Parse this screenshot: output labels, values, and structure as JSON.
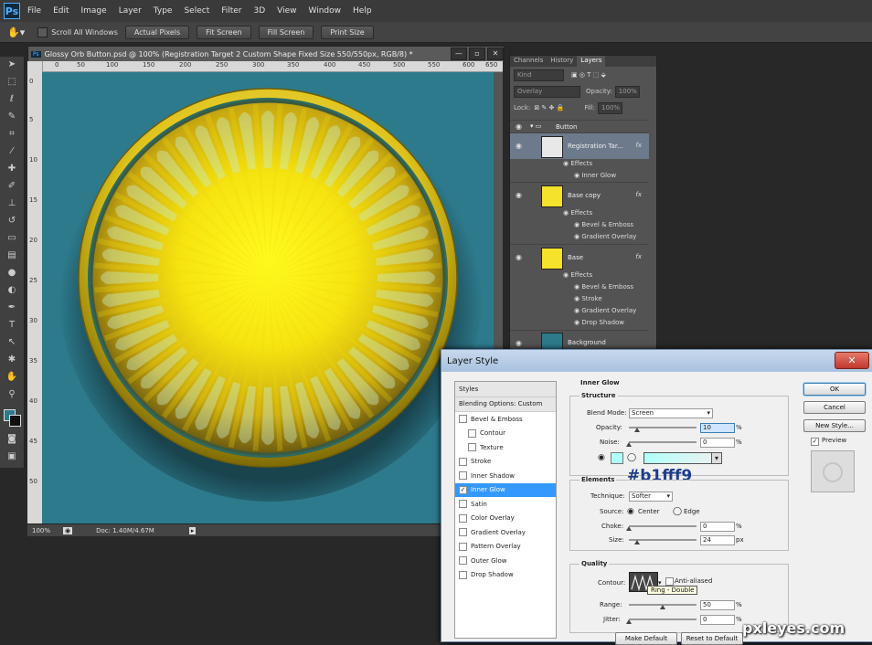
{
  "app": {
    "logo": "Ps"
  },
  "menu": [
    "File",
    "Edit",
    "Image",
    "Layer",
    "Type",
    "Select",
    "Filter",
    "3D",
    "View",
    "Window",
    "Help"
  ],
  "options": {
    "scroll_all": "Scroll All Windows",
    "buttons": [
      "Actual Pixels",
      "Fit Screen",
      "Fill Screen",
      "Print Size"
    ]
  },
  "document": {
    "title": "Glossy Orb Button.psd @ 100% (Registration Target 2 Custom Shape  Fixed Size 550/550px, RGB/8) *",
    "ruler_top": [
      "0",
      "50",
      "100",
      "150",
      "200",
      "250",
      "300",
      "350",
      "400",
      "450",
      "500",
      "550",
      "600",
      "650"
    ],
    "ruler_left": [
      "0",
      "5",
      "10",
      "15",
      "20",
      "25",
      "30",
      "35",
      "40",
      "45",
      "50"
    ],
    "zoom": "100%",
    "doc_info": "Doc: 1.40M/4.67M",
    "canvas_color": "#2d7a8c"
  },
  "panel": {
    "tabs": [
      "Channels",
      "History",
      "Layers"
    ],
    "kind": "Kind",
    "blend": "Overlay",
    "opacity_label": "Opacity:",
    "opacity_value": "100%",
    "lock_label": "Lock:",
    "fill_label": "Fill:",
    "fill_value": "100%",
    "group": "Button",
    "layers": [
      {
        "name": "Registration Tar...",
        "effects_label": "Effects",
        "effects": [
          "Inner Glow"
        ]
      },
      {
        "name": "Base copy",
        "effects_label": "Effects",
        "effects": [
          "Bevel & Emboss",
          "Gradient Overlay"
        ]
      },
      {
        "name": "Base",
        "effects_label": "Effects",
        "effects": [
          "Bevel & Emboss",
          "Stroke",
          "Gradient Overlay",
          "Drop Shadow"
        ]
      },
      {
        "name": "Background"
      }
    ],
    "fx": "fx"
  },
  "dialog": {
    "title": "Layer Style",
    "close": "✕",
    "styles_header": "Styles",
    "blending": "Blending Options: Custom",
    "styles": [
      {
        "label": "Bevel & Emboss",
        "checked": false
      },
      {
        "label": "Contour",
        "checked": false,
        "indent": true
      },
      {
        "label": "Texture",
        "checked": false,
        "indent": true
      },
      {
        "label": "Stroke",
        "checked": false
      },
      {
        "label": "Inner Shadow",
        "checked": false
      },
      {
        "label": "Inner Glow",
        "checked": true
      },
      {
        "label": "Satin",
        "checked": false
      },
      {
        "label": "Color Overlay",
        "checked": false
      },
      {
        "label": "Gradient Overlay",
        "checked": false
      },
      {
        "label": "Pattern Overlay",
        "checked": false
      },
      {
        "label": "Outer Glow",
        "checked": false
      },
      {
        "label": "Drop Shadow",
        "checked": false
      }
    ],
    "section_title": "Inner Glow",
    "structure": "Structure",
    "blend_mode_label": "Blend Mode:",
    "blend_mode": "Screen",
    "opacity_label": "Opacity:",
    "opacity": "10",
    "noise_label": "Noise:",
    "noise": "0",
    "pct": "%",
    "elements": "Elements",
    "technique_label": "Technique:",
    "technique": "Softer",
    "source_label": "Source:",
    "center": "Center",
    "edge": "Edge",
    "choke_label": "Choke:",
    "choke": "0",
    "size_label": "Size:",
    "size": "24",
    "px": "px",
    "quality": "Quality",
    "contour_label": "Contour:",
    "anti_aliased": "Anti-aliased",
    "contour_tip": "Ring - Double",
    "range_label": "Range:",
    "range": "50",
    "jitter_label": "Jitter:",
    "jitter": "0",
    "make_default": "Make Default",
    "reset_default": "Reset to Default",
    "ok": "OK",
    "cancel": "Cancel",
    "new_style": "New Style...",
    "preview": "Preview",
    "glow_color": "#b1fff9",
    "annotation": "#b1fff9"
  },
  "watermark": "pxleyes.com",
  "icons": {
    "eye": "eye-icon",
    "folder": "folder-icon",
    "hand": "hand-tool-icon"
  }
}
